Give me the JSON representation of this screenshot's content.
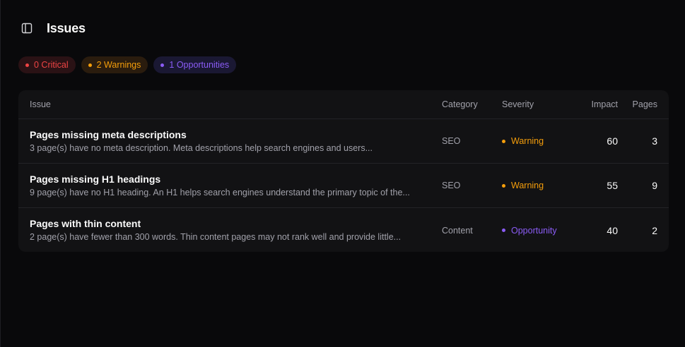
{
  "header": {
    "title": "Issues",
    "toggle_icon": "sidebar-toggle-icon"
  },
  "badges": {
    "critical": "0 Critical",
    "warnings": "2 Warnings",
    "opportunities": "1 Opportunities"
  },
  "colors": {
    "critical": "#ef4444",
    "warning": "#f59e0b",
    "opportunity": "#8b5cf6",
    "background": "#09090b",
    "panel": "#121214"
  },
  "table": {
    "columns": {
      "issue": "Issue",
      "category": "Category",
      "severity": "Severity",
      "impact": "Impact",
      "pages": "Pages"
    },
    "rows": [
      {
        "title": "Pages missing meta descriptions",
        "description": "3 page(s) have no meta description. Meta descriptions help search engines and users...",
        "category": "SEO",
        "severity": "Warning",
        "severity_level": "warning",
        "impact": "60",
        "pages": "3"
      },
      {
        "title": "Pages missing H1 headings",
        "description": "9 page(s) have no H1 heading. An H1 helps search engines understand the primary topic of the...",
        "category": "SEO",
        "severity": "Warning",
        "severity_level": "warning",
        "impact": "55",
        "pages": "9"
      },
      {
        "title": "Pages with thin content",
        "description": "2 page(s) have fewer than 300 words. Thin content pages may not rank well and provide little...",
        "category": "Content",
        "severity": "Opportunity",
        "severity_level": "opportunity",
        "impact": "40",
        "pages": "2"
      }
    ]
  }
}
